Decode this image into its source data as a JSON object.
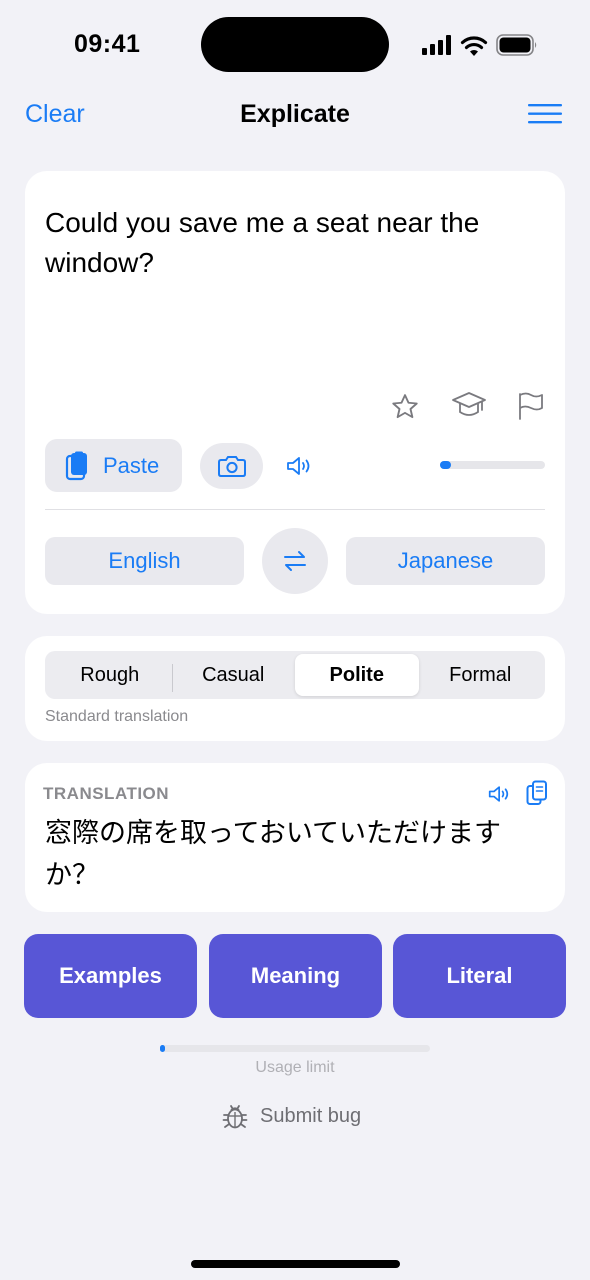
{
  "status": {
    "time": "09:41"
  },
  "nav": {
    "clear_label": "Clear",
    "title": "Explicate"
  },
  "input": {
    "text": "Could you save me a seat near the window?",
    "paste_label": "Paste",
    "progress": 0.1
  },
  "languages": {
    "source": "English",
    "target": "Japanese"
  },
  "tone": {
    "options": [
      "Rough",
      "Casual",
      "Polite",
      "Formal"
    ],
    "selected": "Polite",
    "caption": "Standard translation"
  },
  "translation": {
    "label": "TRANSLATION",
    "text": "窓際の席を取っておいていただけますか？"
  },
  "actions": {
    "examples": "Examples",
    "meaning": "Meaning",
    "literal": "Literal"
  },
  "usage": {
    "label": "Usage limit",
    "progress": 0.02
  },
  "bug": {
    "label": "Submit bug"
  },
  "colors": {
    "accent": "#1a7cf5",
    "action": "#5856d6",
    "background": "#f2f2f7"
  }
}
